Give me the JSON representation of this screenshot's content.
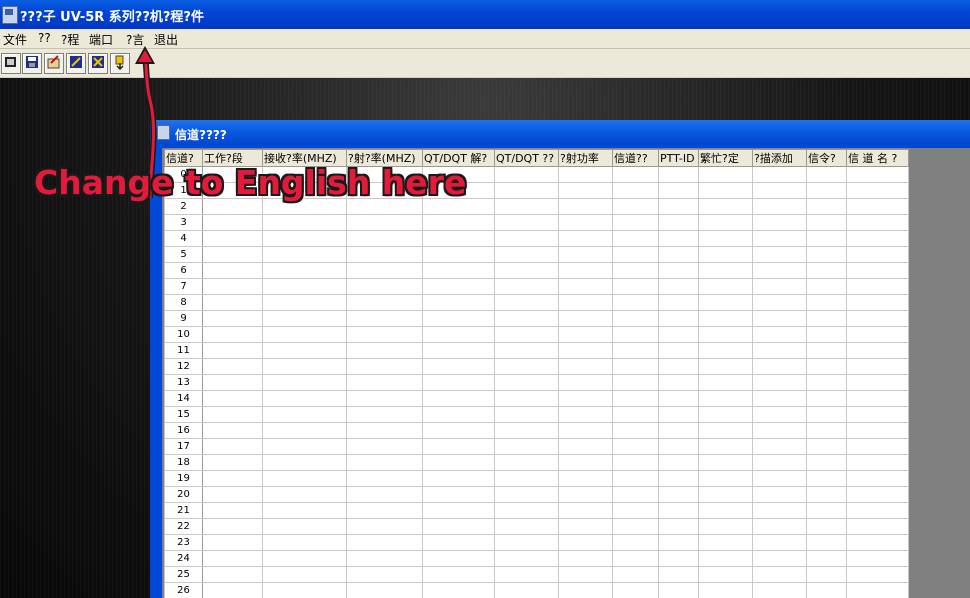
{
  "window": {
    "title": "???子 UV-5R 系列??机?程?件"
  },
  "menu": {
    "items": [
      "文件",
      "??",
      "?程",
      "端口",
      "?言",
      "退出"
    ]
  },
  "toolbar": {
    "buttons": [
      "open-icon",
      "save-icon",
      "read-from-radio-icon",
      "write-to-radio-icon",
      "monitor-icon",
      "exit-icon"
    ]
  },
  "child_window": {
    "title": "信道????"
  },
  "grid": {
    "columns": [
      "信道?",
      "工作?段",
      "接收?率(MHZ)",
      "?射?率(MHZ)",
      "QT/DQT 解?",
      "QT/DQT ??",
      "?射功率",
      "信道??",
      "PTT-ID",
      "繁忙?定",
      "?描添加",
      "信令?",
      "信 道 名 ?"
    ],
    "rows": [
      "0",
      "1",
      "2",
      "3",
      "4",
      "5",
      "6",
      "7",
      "8",
      "9",
      "10",
      "11",
      "12",
      "13",
      "14",
      "15",
      "16",
      "17",
      "18",
      "19",
      "20",
      "21",
      "22",
      "23",
      "24",
      "25",
      "26"
    ]
  },
  "annotation": {
    "text": "Change to English here",
    "color": "#e31b3a"
  },
  "colors": {
    "title_bar": "#0246d6",
    "menu_bg": "#ece9d8",
    "workspace": "#151515"
  }
}
